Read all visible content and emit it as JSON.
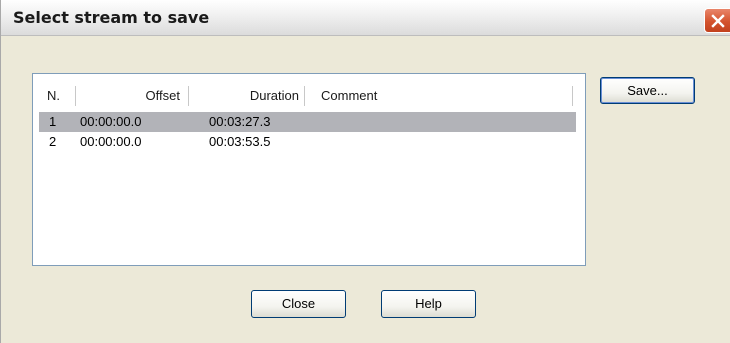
{
  "window": {
    "title": "Select stream to save"
  },
  "list": {
    "columns": [
      {
        "label": "N."
      },
      {
        "label": "Offset"
      },
      {
        "label": "Duration"
      },
      {
        "label": "Comment"
      }
    ],
    "rows": [
      {
        "n": "1",
        "offset": "00:00:00.0",
        "duration": "00:03:27.3",
        "comment": "",
        "selected": true
      },
      {
        "n": "2",
        "offset": "00:00:00.0",
        "duration": "00:03:53.5",
        "comment": "",
        "selected": false
      }
    ]
  },
  "buttons": {
    "save": "Save...",
    "close": "Close",
    "help": "Help"
  },
  "colors": {
    "selection": "#b2b3b8",
    "dialog_bg": "#ece9d8",
    "close_button": "#d4532e"
  }
}
